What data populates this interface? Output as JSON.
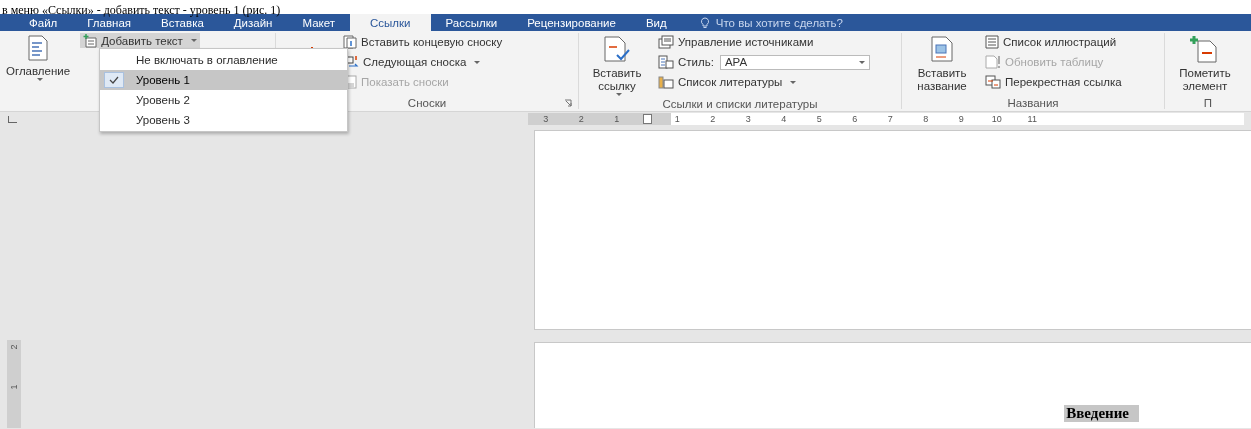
{
  "caption": "в меню «Ссылки» - добавить текст - уровень 1 (рис. 1)",
  "tabs": [
    {
      "label": "Файл",
      "selected": false
    },
    {
      "label": "Главная",
      "selected": false
    },
    {
      "label": "Вставка",
      "selected": false
    },
    {
      "label": "Дизайн",
      "selected": false
    },
    {
      "label": "Макет",
      "selected": false
    },
    {
      "label": "Ссылки",
      "selected": true
    },
    {
      "label": "Рассылки",
      "selected": false
    },
    {
      "label": "Рецензирование",
      "selected": false
    },
    {
      "label": "Вид",
      "selected": false
    }
  ],
  "tell_me": {
    "placeholder": "Что вы хотите сделать?"
  },
  "groups": [
    {
      "large": [
        {
          "kind": "toc",
          "label": "Оглавление",
          "dropdown": true
        }
      ],
      "commands": [
        {
          "kind": "add-text",
          "label": "Добавить текст",
          "dropdown": true,
          "disabled": false,
          "pressed": true
        }
      ]
    },
    {
      "large": [
        {
          "kind": "footnote"
        }
      ],
      "commands": [
        {
          "kind": "endnote",
          "label": "Вставить концевую сноску",
          "dropdown": false,
          "disabled": false,
          "pressed": false
        },
        {
          "kind": "next",
          "label": "Следующая сноска",
          "dropdown": true,
          "disabled": false,
          "pressed": false
        },
        {
          "kind": "show",
          "label": "Показать сноски",
          "dropdown": false,
          "disabled": true,
          "pressed": false
        }
      ],
      "label": "Сноски",
      "launcher": true
    },
    {
      "large": [
        {
          "kind": "citation",
          "label": "Вставить ссылку",
          "dropdown": true
        }
      ],
      "commands": [
        {
          "kind": "sources",
          "label": "Управление источниками",
          "dropdown": false,
          "disabled": false,
          "pressed": false
        },
        {
          "kind": "style",
          "label": "Стиль:",
          "value": "APA"
        },
        {
          "kind": "bibliography",
          "label": "Список литературы",
          "dropdown": true,
          "disabled": false,
          "pressed": false
        }
      ],
      "label": "Ссылки и списки литературы",
      "launcher": false
    },
    {
      "large": [
        {
          "kind": "caption",
          "label": "Вставить название",
          "dropdown": false
        }
      ],
      "commands": [
        {
          "kind": "figures",
          "label": "Список иллюстраций",
          "dropdown": false,
          "disabled": false,
          "pressed": false
        },
        {
          "kind": "update",
          "label": "Обновить таблицу",
          "dropdown": false,
          "disabled": true,
          "pressed": false
        },
        {
          "kind": "crossref",
          "label": "Перекрестная ссылка",
          "dropdown": false,
          "disabled": false,
          "pressed": false
        }
      ],
      "label": "Названия",
      "launcher": false
    },
    {
      "large": [
        {
          "kind": "mark",
          "label": "Пометить элемент",
          "dropdown": false
        }
      ],
      "label": "П",
      "launcher": false
    }
  ],
  "menu": {
    "items": [
      {
        "label": "Не включать в оглавление",
        "selected": false
      },
      {
        "label": "Уровень 1",
        "selected": true
      },
      {
        "label": "Уровень 2",
        "selected": false
      },
      {
        "label": "Уровень 3",
        "selected": false
      }
    ]
  },
  "ruler": {
    "labels": [
      "3",
      "2",
      "1",
      "1",
      "2",
      "3",
      "4",
      "5",
      "6",
      "7",
      "8",
      "9",
      "10",
      "11"
    ]
  },
  "vertical_ruler": {
    "labels": [
      "2",
      "1"
    ]
  },
  "document": {
    "heading": "Введение"
  }
}
